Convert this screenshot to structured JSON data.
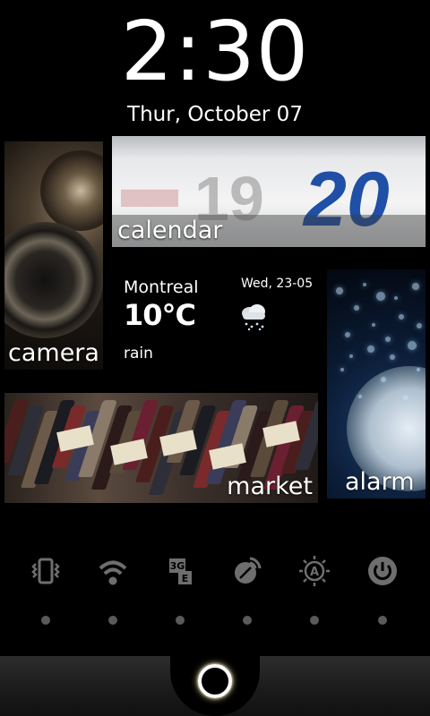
{
  "lockscreen": {
    "time": "2:30",
    "date": "Thur, October 07"
  },
  "tiles": {
    "camera": {
      "label": "camera"
    },
    "calendar": {
      "label": "calendar",
      "image_numbers": [
        "19",
        "20"
      ]
    },
    "alarm": {
      "label": "alarm"
    },
    "market": {
      "label": "market"
    }
  },
  "weather": {
    "city": "Montreal",
    "temperature": "10°C",
    "condition": "rain",
    "updated": "Wed, 23-05",
    "icon": "rain-cloud-icon"
  },
  "toggles": [
    {
      "name": "vibrate-toggle",
      "icon": "vibrate-icon"
    },
    {
      "name": "wifi-toggle",
      "icon": "wifi-icon"
    },
    {
      "name": "mobile-data-toggle",
      "icon": "3g-icon",
      "label": "3G"
    },
    {
      "name": "sync-toggle",
      "icon": "sync-icon"
    },
    {
      "name": "auto-brightness-toggle",
      "icon": "brightness-auto-icon",
      "label": "A"
    },
    {
      "name": "power-toggle",
      "icon": "power-icon"
    }
  ],
  "colors": {
    "background": "#000000",
    "icon": "#6e6e6e",
    "dot": "#5a5a5a",
    "calendar_blue": "#1f4fa6"
  },
  "unlock": {
    "icon": "unlock-ring-icon"
  }
}
